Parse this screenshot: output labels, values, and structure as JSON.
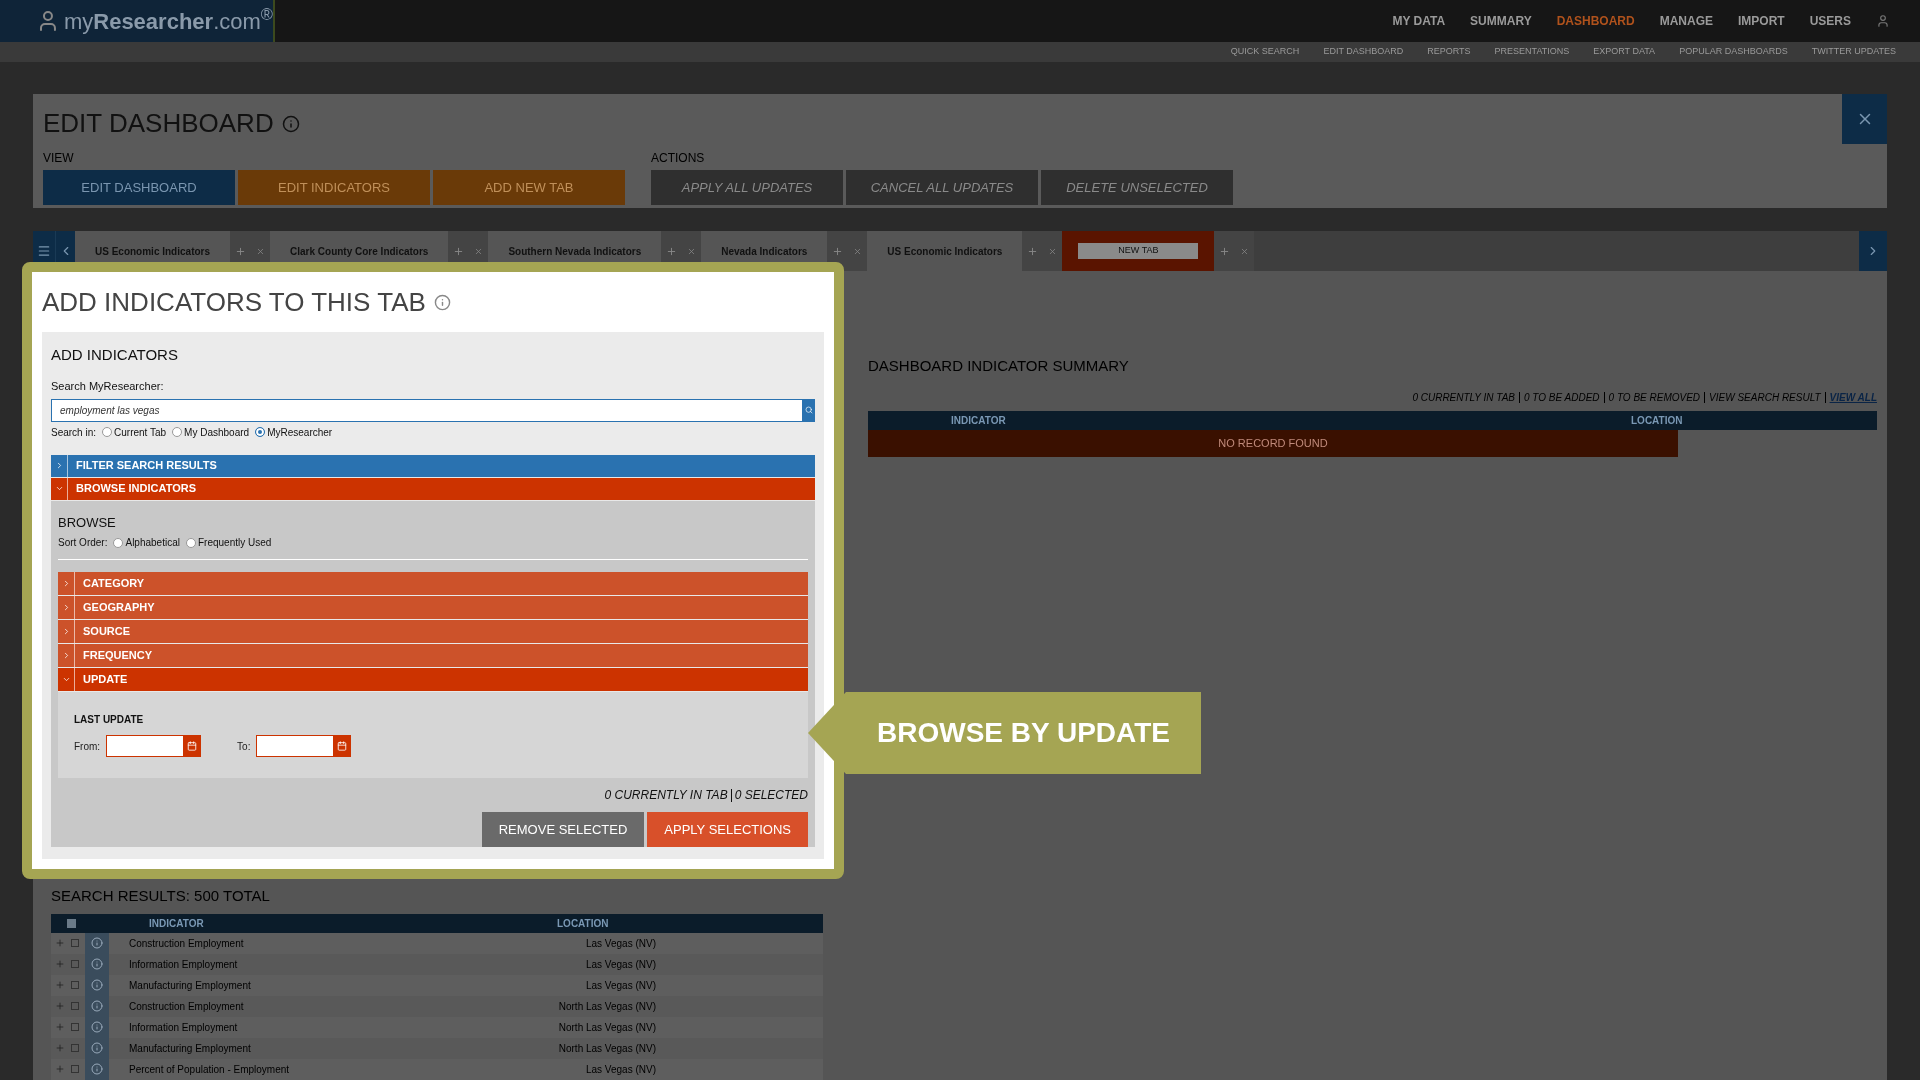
{
  "brand": {
    "name": "my**Researcher**.com$^{®}$"
  },
  "nav": [
    {
      "label": "MY DATA",
      "selected": false
    },
    {
      "label": "SUMMARY",
      "selected": false
    },
    {
      "label": "DASHBOARD",
      "selected": true
    },
    {
      "label": "MANAGE",
      "selected": false
    },
    {
      "label": "IMPORT",
      "selected": false
    },
    {
      "label": "USERS",
      "selected": false
    }
  ],
  "subnav": [
    "QUICK SEARCH",
    "EDIT DASHBOARD",
    "REPORTS",
    "PRESENTATIONS",
    "EXPORT DATA",
    "POPULAR DASHBOARDS",
    "TWITTER UPDATES"
  ],
  "edit_dashboard": {
    "title": "EDIT DASHBOARD",
    "view_label": "VIEW",
    "view_buttons": [
      {
        "label": "EDIT DASHBOARD",
        "selected": true
      },
      {
        "label": "EDIT INDICATORS",
        "selected": false
      },
      {
        "label": "ADD NEW TAB",
        "selected": false
      }
    ],
    "actions_label": "ACTIONS",
    "action_buttons": [
      {
        "label": "APPLY ALL UPDATES",
        "disabled": true
      },
      {
        "label": "CANCEL ALL UPDATES",
        "disabled": true
      },
      {
        "label": "DELETE UNSELECTED",
        "disabled": true
      }
    ]
  },
  "tabs": [
    {
      "label": "US Economic Indicators",
      "selected": false
    },
    {
      "label": "Clark County Core Indicators",
      "selected": false
    },
    {
      "label": "Southern Nevada Indicators",
      "selected": false
    },
    {
      "label": "Nevada Indicators",
      "selected": false
    },
    {
      "label": "US Economic Indicators",
      "selected": false
    },
    {
      "label": "NEW TAB",
      "selected": true
    }
  ],
  "popup": {
    "title": "ADD INDICATORS TO THIS TAB",
    "section_title": "ADD INDICATORS",
    "search_label": "Search MyResearcher:",
    "search_value": "employment las vegas",
    "search_in_label": "Search in:",
    "search_in": [
      {
        "label": "Current Tab",
        "selected": false
      },
      {
        "label": "My Dashboard",
        "selected": false
      },
      {
        "label": "MyResearcher",
        "selected": true
      }
    ],
    "panels": [
      {
        "label": "FILTER SEARCH RESULTS",
        "expanded": false,
        "color": "#2a72b0"
      },
      {
        "label": "BROWSE INDICATORS",
        "expanded": true,
        "color": "#cc3300"
      }
    ],
    "browse_title": "BROWSE",
    "sort_label": "Sort Order:",
    "sort_options": [
      {
        "label": "Alphabetical",
        "selected": false
      },
      {
        "label": "Frequently Used",
        "selected": false
      }
    ],
    "facets": [
      {
        "label": "CATEGORY",
        "expanded": false
      },
      {
        "label": "GEOGRAPHY",
        "expanded": false
      },
      {
        "label": "SOURCE",
        "expanded": false
      },
      {
        "label": "FREQUENCY",
        "expanded": false
      },
      {
        "label": "UPDATE",
        "expanded": true
      }
    ],
    "last_update": "LAST UPDATE",
    "from_label": "From:",
    "to_label": "To:",
    "status": [
      "0 CURRENTLY IN TAB",
      "0 SELECTED"
    ],
    "buttons": [
      {
        "label": "REMOVE SELECTED",
        "kind": "secondary"
      },
      {
        "label": "APPLY SELECTIONS",
        "kind": "primary"
      }
    ]
  },
  "callout": {
    "text": "BROWSE BY UPDATE"
  },
  "summary": {
    "title": "DASHBOARD INDICATOR SUMMARY",
    "status": [
      "0 CURRENTLY IN TAB",
      "0 TO BE ADDED",
      "0 TO BE REMOVED",
      "VIEW SEARCH RESULT"
    ],
    "link": "VIEW ALL",
    "columns": [
      "INDICATOR",
      "LOCATION"
    ],
    "empty": "NO RECORD FOUND"
  },
  "search_results": {
    "title": "SEARCH RESULTS: 500 TOTAL",
    "select_all": {
      "checked": false
    },
    "columns": [
      "INDICATOR",
      "LOCATION"
    ],
    "rows": [
      {
        "indicator": "Construction Employment",
        "location": "Las Vegas (NV)",
        "checked": false
      },
      {
        "indicator": "Information Employment",
        "location": "Las Vegas (NV)",
        "checked": false
      },
      {
        "indicator": "Manufacturing Employment",
        "location": "Las Vegas (NV)",
        "checked": false
      },
      {
        "indicator": "Construction Employment",
        "location": "North Las Vegas (NV)",
        "checked": false
      },
      {
        "indicator": "Information Employment",
        "location": "North Las Vegas (NV)",
        "checked": false
      },
      {
        "indicator": "Manufacturing Employment",
        "location": "North Las Vegas (NV)",
        "checked": false
      },
      {
        "indicator": "Percent of Population - Employment",
        "location": "Las Vegas (NV)",
        "checked": false
      }
    ]
  }
}
